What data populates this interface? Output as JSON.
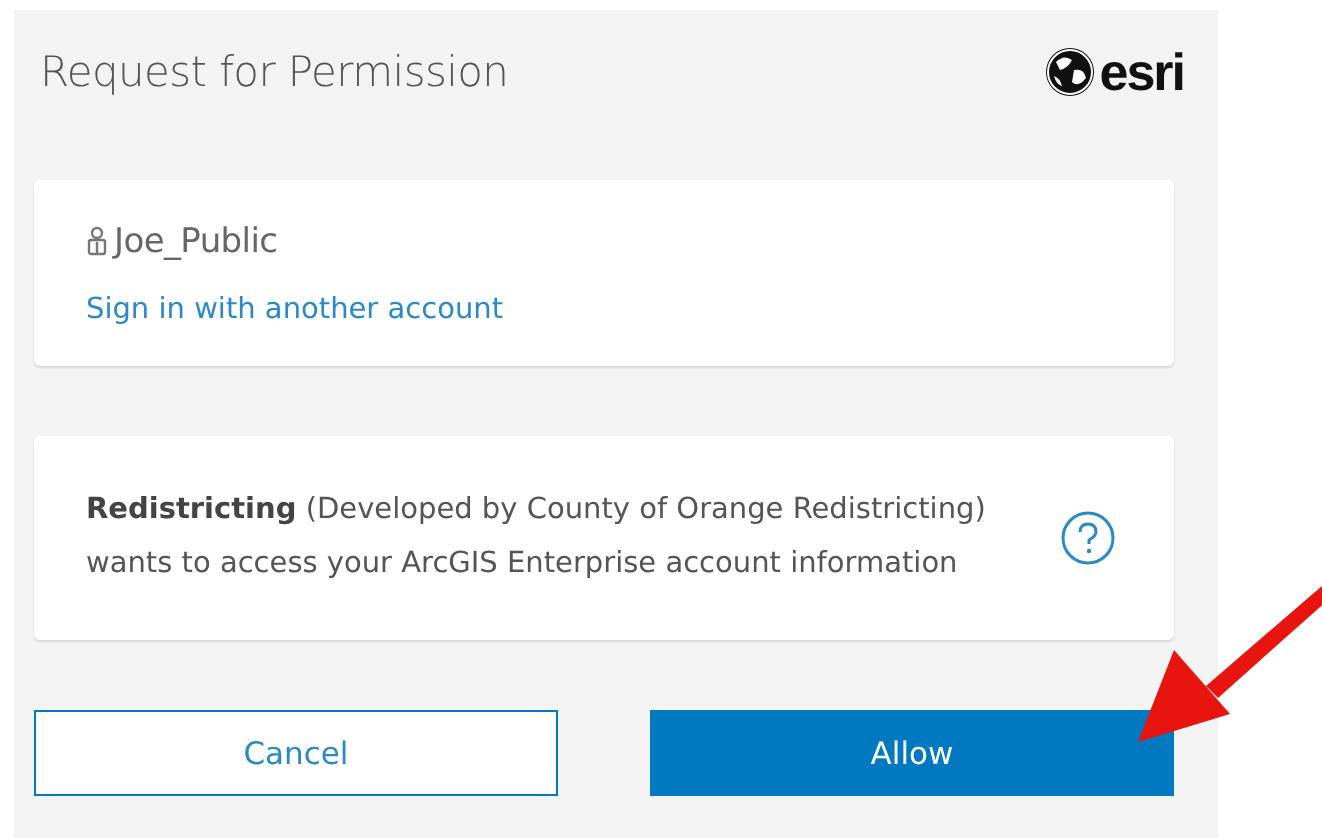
{
  "dialog": {
    "title": "Request for Permission",
    "logo_text": "esri"
  },
  "account": {
    "username": "Joe_Public",
    "switch_link": "Sign in with another account"
  },
  "request": {
    "message": "**Redistricting** (Developed by County of Orange Redistricting) wants to access your ArcGIS Enterprise account information"
  },
  "buttons": [
    {
      "label": "Cancel",
      "kind": "secondary"
    },
    {
      "label": "Allow",
      "kind": "primary"
    }
  ]
}
